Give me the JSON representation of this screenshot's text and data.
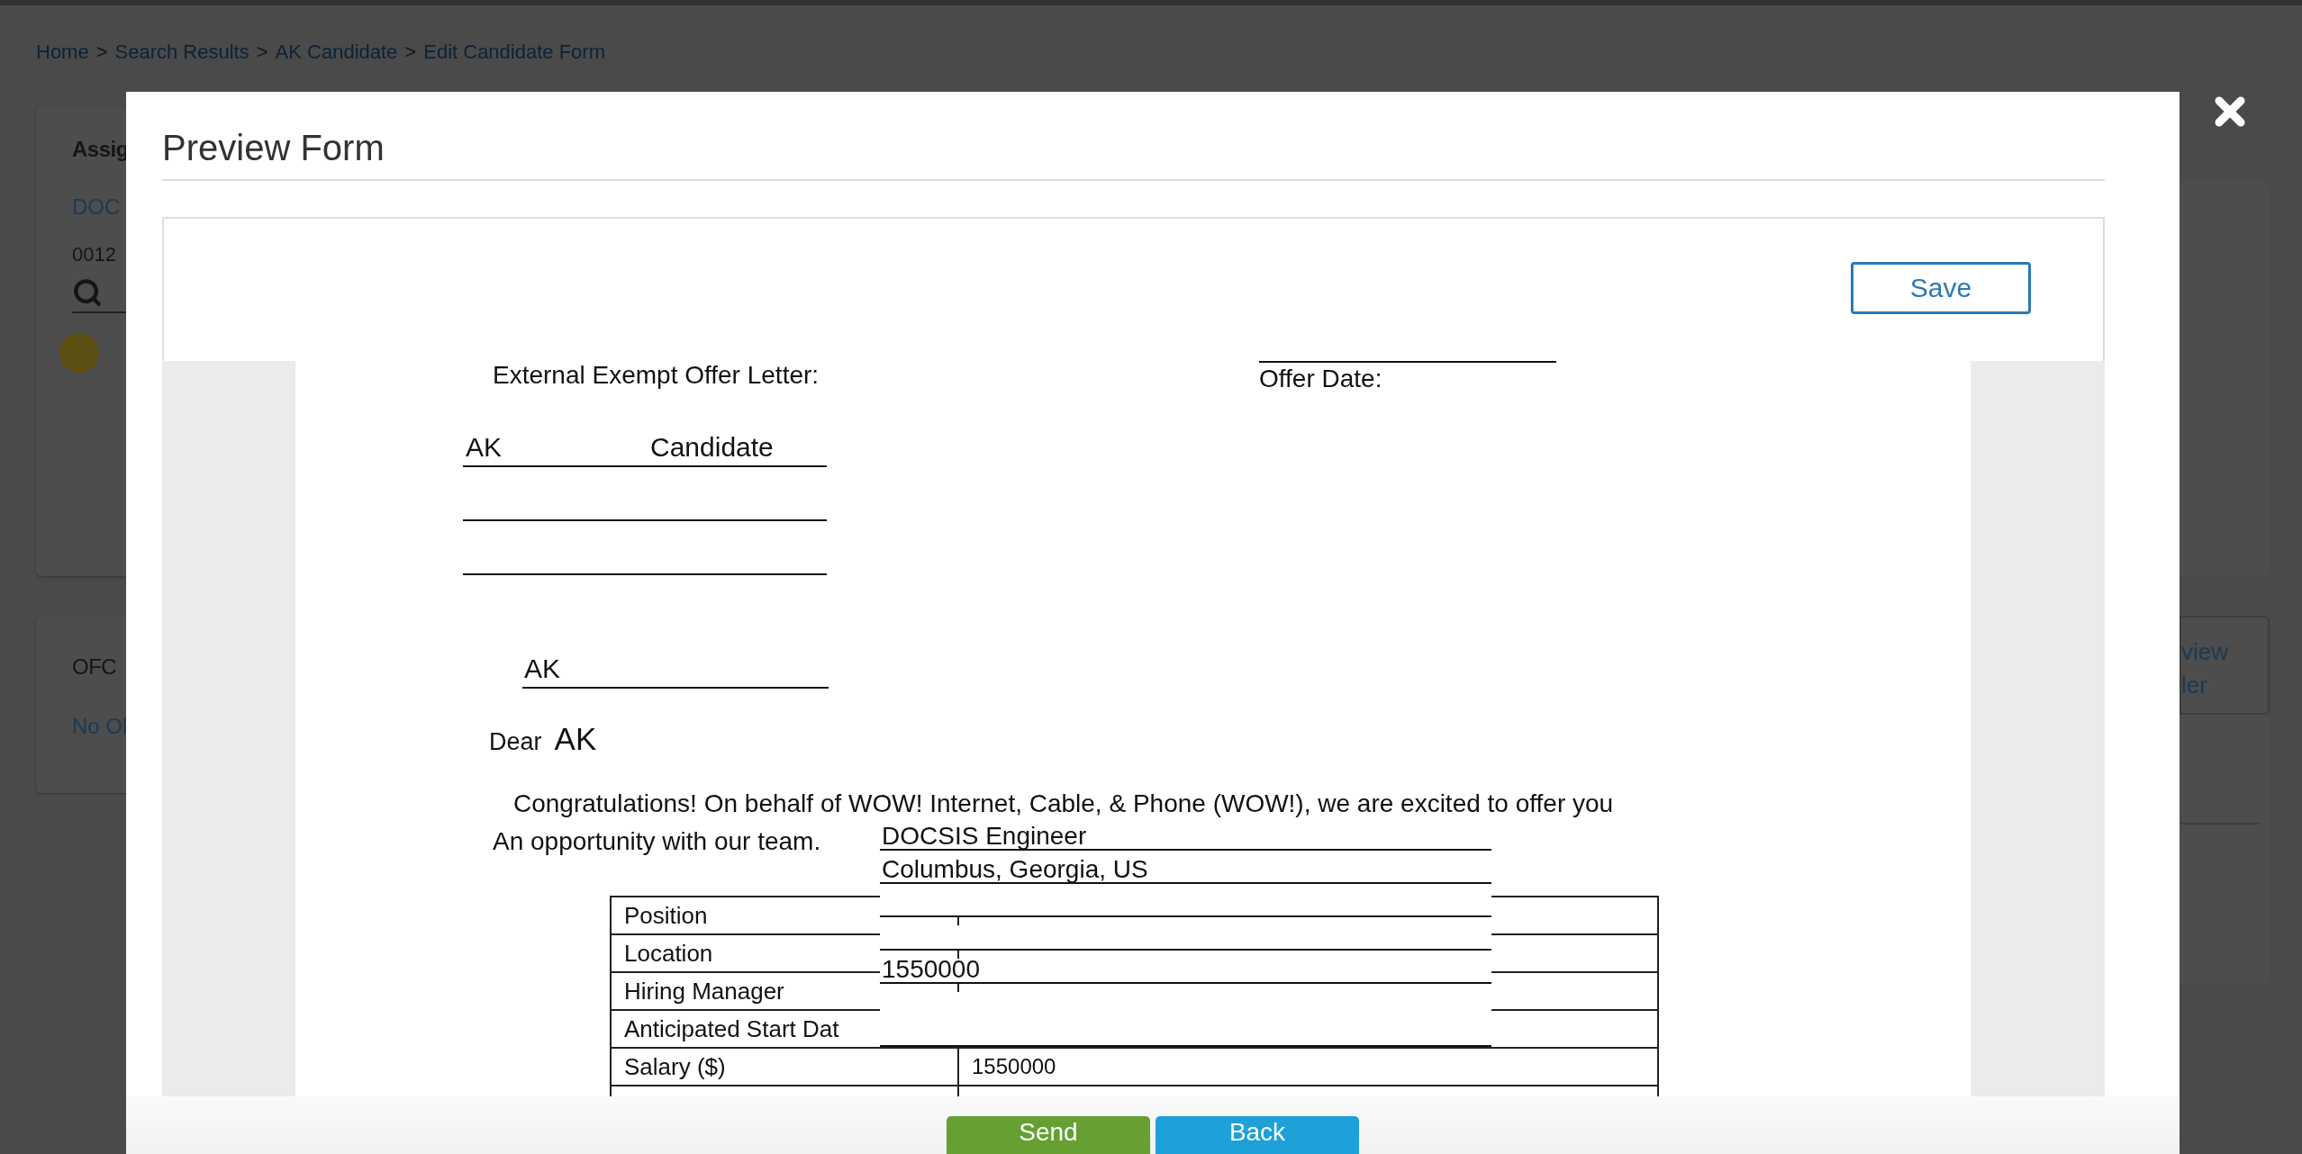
{
  "breadcrumbs": {
    "separator": ">",
    "items": [
      {
        "label": "Home"
      },
      {
        "label": "Search Results"
      },
      {
        "label": "AK Candidate"
      },
      {
        "label": "Edit Candidate Form"
      }
    ]
  },
  "background": {
    "left_cards": [
      {
        "kind": "assignment",
        "title": "Assig",
        "link": "DOC",
        "value": "0012"
      },
      {
        "kind": "plain",
        "title": "OFC",
        "link": "No Ol"
      }
    ],
    "right_link_lines": [
      "view",
      "ler"
    ]
  },
  "modal": {
    "title": "Preview Form",
    "save_button": "Save",
    "document": {
      "heading": "External Exempt Offer Letter:",
      "offer_date_label": "Offer Date:",
      "name": {
        "first": "AK",
        "last": "Candidate"
      },
      "address_name": "AK",
      "salutation": "Dear",
      "salutation_name": "AK",
      "paragraph_lines": [
        "Congratulations! On behalf of WOW! Internet, Cable, & Phone (WOW!), we are excited to offer you",
        "An opportunity with our team."
      ],
      "table_rows": [
        {
          "label": "Position"
        },
        {
          "label": "Location"
        },
        {
          "label": "Hiring Manager"
        },
        {
          "label": "Anticipated Start Dat"
        },
        {
          "label": "Salary ($)",
          "value": "1550000"
        }
      ],
      "overlay_fields": [
        {
          "kind": "text",
          "value": "DOCSIS Engineer"
        },
        {
          "kind": "text",
          "value": "Columbus, Georgia, US"
        },
        {
          "kind": "blank"
        },
        {
          "kind": "blank"
        },
        {
          "kind": "text",
          "value": "1550000"
        },
        {
          "kind": "tall"
        }
      ]
    },
    "buttons": [
      {
        "label": "Send",
        "kind": "primary"
      },
      {
        "label": "Back",
        "kind": "secondary"
      }
    ]
  }
}
